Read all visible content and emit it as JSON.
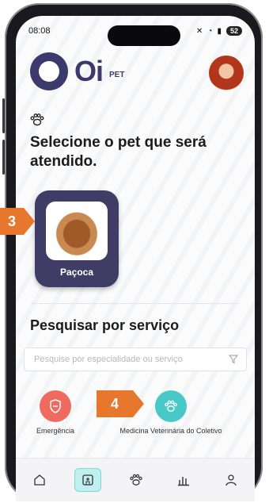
{
  "status_bar": {
    "time": "08:08",
    "battery": "52"
  },
  "header": {
    "logo_text": "Oi",
    "logo_sub": "PET"
  },
  "select_pet": {
    "title": "Selecione o pet que será atendido."
  },
  "pets": [
    {
      "name": "Paçoca"
    }
  ],
  "annotations": [
    {
      "label": "3"
    },
    {
      "label": "4"
    }
  ],
  "search_section": {
    "title": "Pesquisar por serviço",
    "placeholder": "Pesquise por especialidade ou serviço"
  },
  "services": [
    {
      "label": "Emergência",
      "color": "#f06b5f"
    },
    {
      "label": "Medicina Veterinária do Coletivo",
      "color": "#49c8c8"
    }
  ],
  "bottom_nav": [
    {
      "icon": "home-icon"
    },
    {
      "icon": "hospital-icon",
      "active": true
    },
    {
      "icon": "paw-icon"
    },
    {
      "icon": "chart-icon"
    },
    {
      "icon": "profile-icon"
    }
  ],
  "colors": {
    "brand": "#3c3a6c",
    "accent": "#49c8c8",
    "marker": "#e8772e"
  }
}
